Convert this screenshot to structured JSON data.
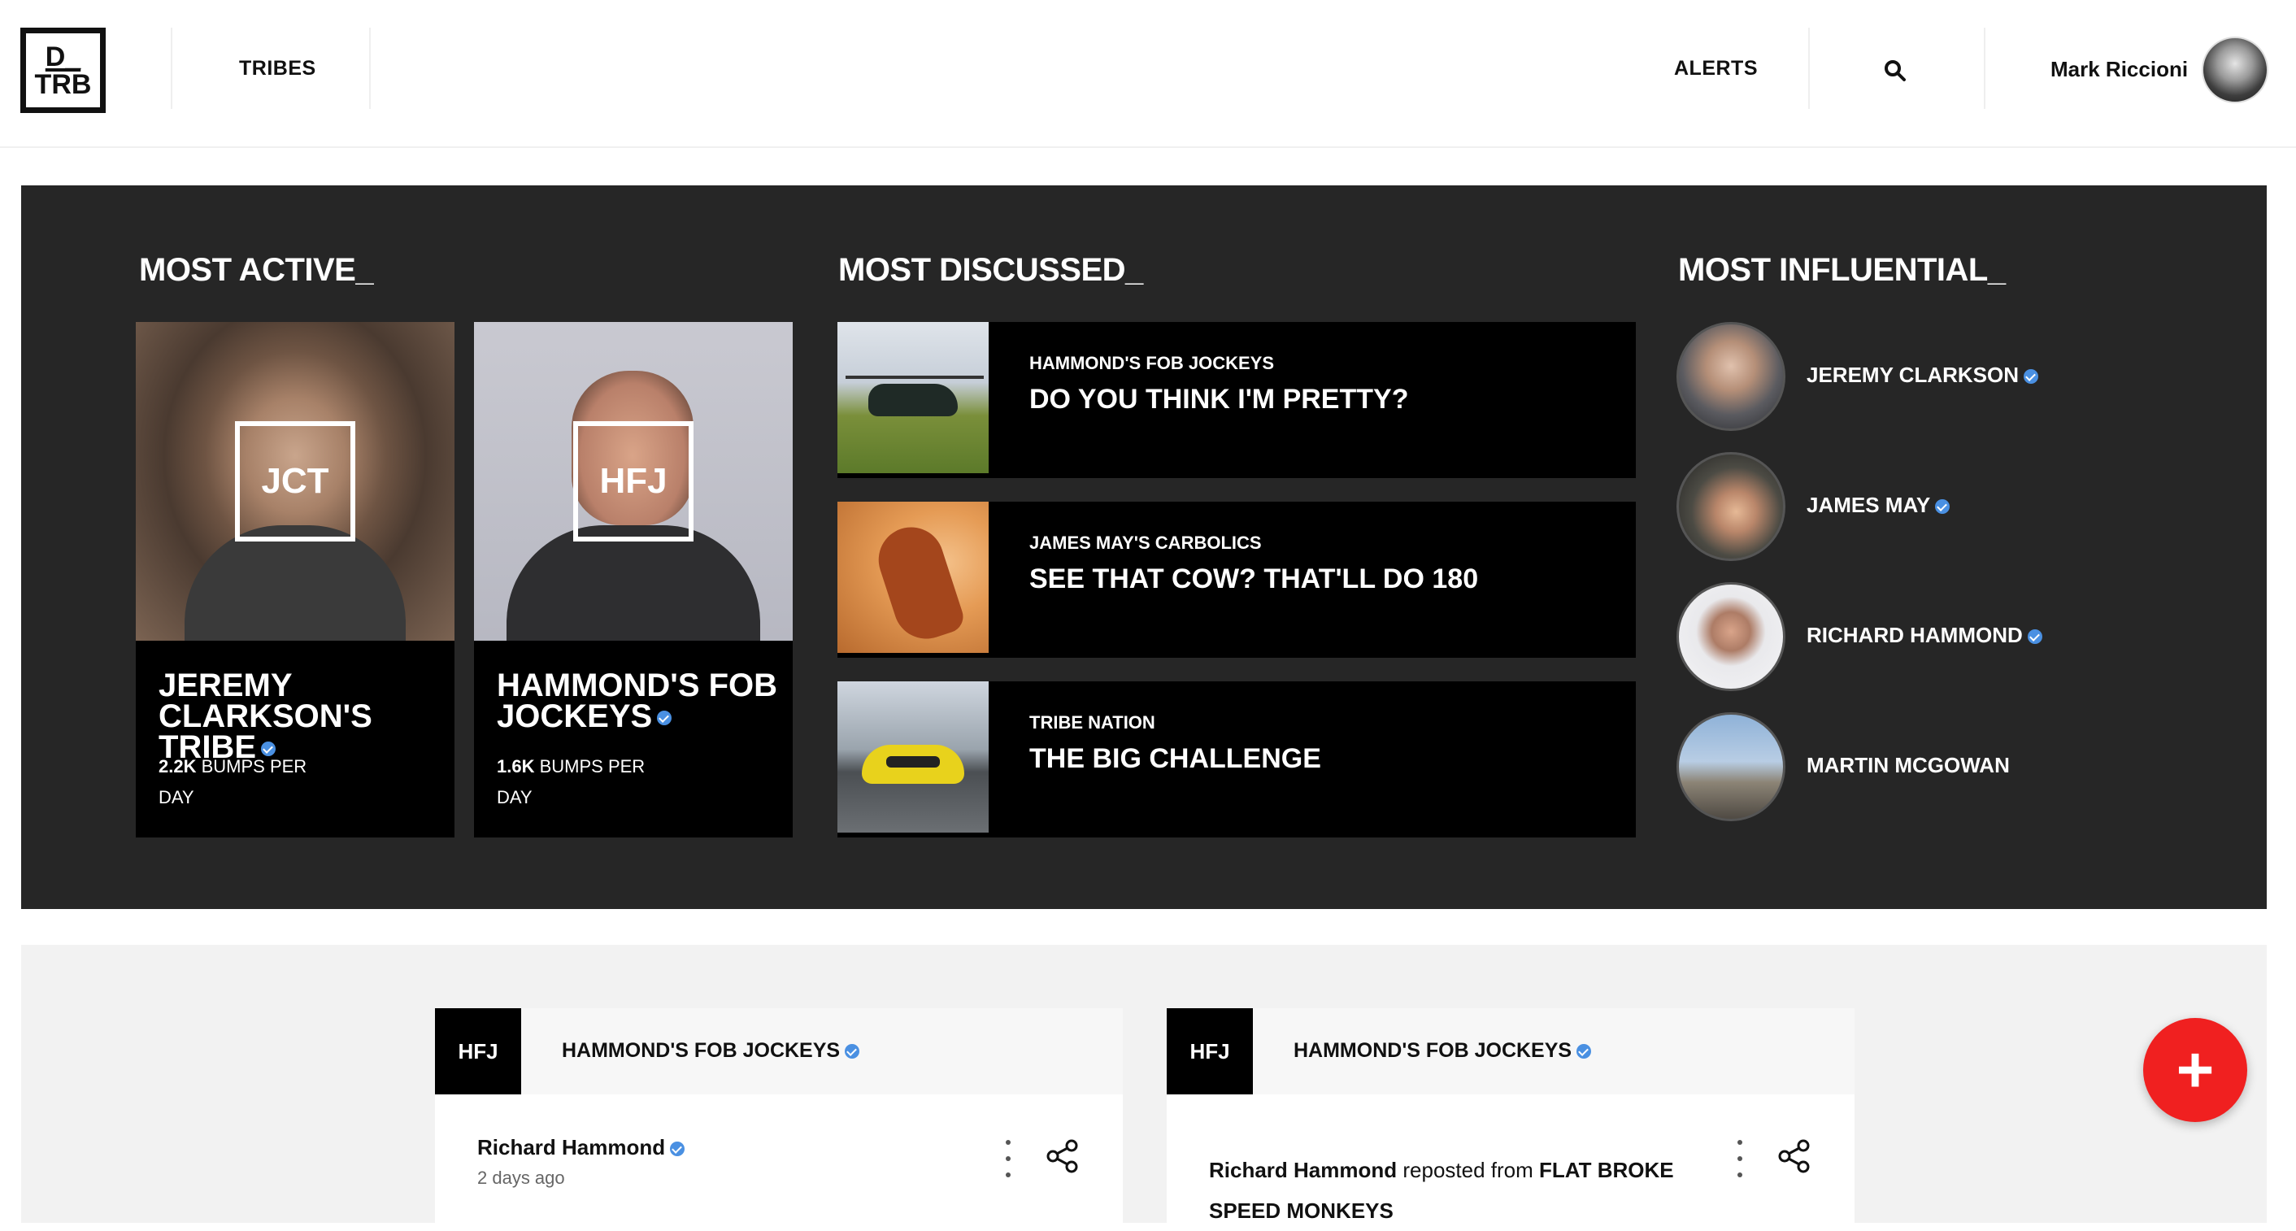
{
  "header": {
    "logo_line1": "D_",
    "logo_line2": "TRB",
    "nav_tribes": "TRIBES",
    "nav_alerts": "ALERTS",
    "user_name": "Mark Riccioni"
  },
  "most_active": {
    "heading": "MOST ACTIVE_",
    "cards": [
      {
        "abbr": "JCT",
        "name": "JEREMY CLARKSON'S TRIBE",
        "bumps": "2.2K",
        "bumps_label": "BUMPS PER DAY"
      },
      {
        "abbr": "HFJ",
        "name": "HAMMOND'S FOB JOCKEYS",
        "bumps": "1.6K",
        "bumps_label": "BUMPS PER DAY"
      }
    ]
  },
  "most_discussed": {
    "heading": "MOST DISCUSSED_",
    "items": [
      {
        "tribe": "HAMMOND'S FOB JOCKEYS",
        "title": "DO YOU THINK I'M PRETTY?"
      },
      {
        "tribe": "JAMES MAY'S CARBOLICS",
        "title": "SEE THAT COW? THAT'LL DO 180"
      },
      {
        "tribe": "TRIBE NATION",
        "title": "THE BIG CHALLENGE"
      }
    ]
  },
  "most_influential": {
    "heading": "MOST INFLUENTIAL_",
    "people": [
      {
        "name": "JEREMY CLARKSON",
        "verified": true
      },
      {
        "name": "JAMES MAY",
        "verified": true
      },
      {
        "name": "RICHARD HAMMOND",
        "verified": true
      },
      {
        "name": "MARTIN MCGOWAN",
        "verified": false
      }
    ]
  },
  "feed": {
    "posts": [
      {
        "badge": "HFJ",
        "tribe": "HAMMOND'S FOB JOCKEYS",
        "author": "Richard Hammond",
        "time": "2 days ago"
      },
      {
        "badge": "HFJ",
        "tribe": "HAMMOND'S FOB JOCKEYS",
        "author": "Richard Hammond",
        "reposted_text": "reposted from",
        "source_line1": "FLAT BROKE SPEED",
        "source_line2": "MONKEYS"
      }
    ]
  },
  "fab": {
    "label": "+"
  },
  "colors": {
    "panel": "#262626",
    "verified": "#4a90e2",
    "fab": "#f02020"
  }
}
